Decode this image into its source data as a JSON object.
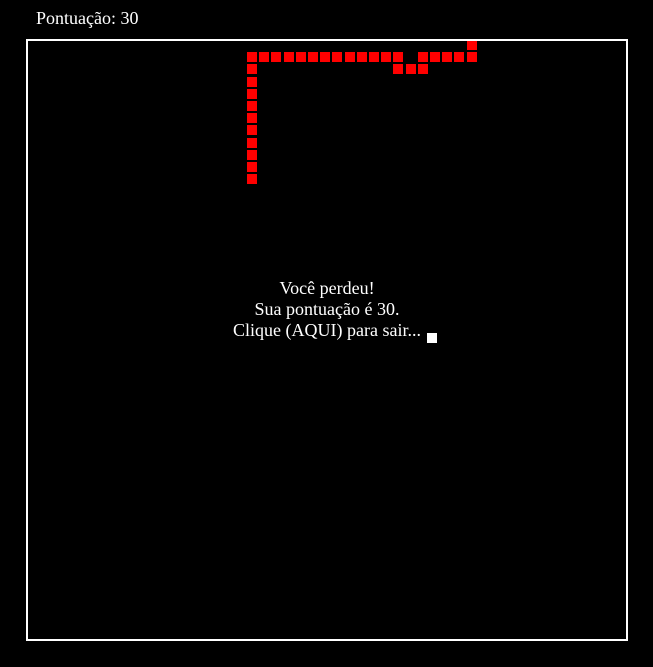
{
  "hud": {
    "score_label": "Pontuação: 30"
  },
  "game_over": {
    "title": "Você perdeu!",
    "score_message": "Sua pontuação é 30.",
    "exit_prompt": "Clique (AQUI) para sair..."
  },
  "colors": {
    "background": "#000000",
    "border": "#ffffff",
    "snake": "#ff0000",
    "food": "#ffffff",
    "text": "#ffffff"
  },
  "snake": {
    "cell_size": 12.2,
    "segments": [
      [
        18,
        0
      ],
      [
        18,
        1
      ],
      [
        17,
        1
      ],
      [
        16,
        1
      ],
      [
        15,
        1
      ],
      [
        14,
        1
      ],
      [
        14,
        2
      ],
      [
        13,
        2
      ],
      [
        12,
        2
      ],
      [
        12,
        1
      ],
      [
        11,
        1
      ],
      [
        10,
        1
      ],
      [
        9,
        1
      ],
      [
        8,
        1
      ],
      [
        7,
        1
      ],
      [
        6,
        1
      ],
      [
        5,
        1
      ],
      [
        4,
        1
      ],
      [
        3,
        1
      ],
      [
        2,
        1
      ],
      [
        1,
        1
      ],
      [
        0,
        1
      ],
      [
        0,
        2
      ],
      [
        0,
        3
      ],
      [
        0,
        4
      ],
      [
        0,
        5
      ],
      [
        0,
        6
      ],
      [
        0,
        7
      ],
      [
        0,
        8
      ],
      [
        0,
        9
      ],
      [
        0,
        10
      ],
      [
        0,
        11
      ]
    ]
  }
}
